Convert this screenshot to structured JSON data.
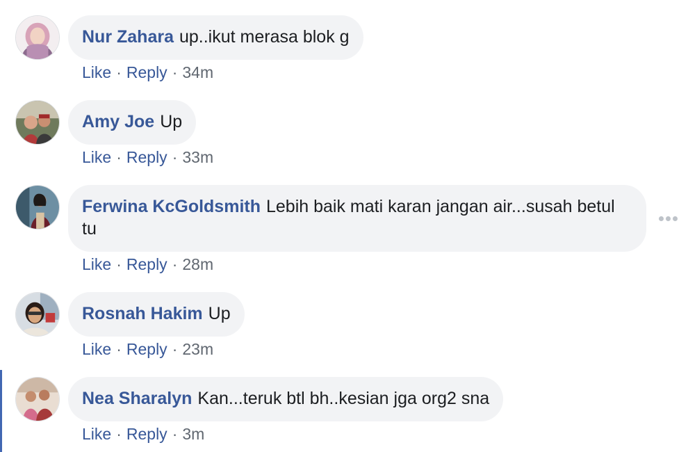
{
  "comments": [
    {
      "author": "Nur Zahara",
      "text": "up..ikut merasa blok g",
      "like": "Like",
      "reply": "Reply",
      "sep": "·",
      "time": "34m",
      "avatar_icon": "user-photo-icon"
    },
    {
      "author": "Amy Joe",
      "text": "Up",
      "like": "Like",
      "reply": "Reply",
      "sep": "·",
      "time": "33m",
      "avatar_icon": "user-photo-icon"
    },
    {
      "author": "Ferwina KcGoldsmith",
      "text": "Lebih baik mati karan jangan air...susah betul tu",
      "like": "Like",
      "reply": "Reply",
      "sep": "·",
      "time": "28m",
      "avatar_icon": "user-photo-icon"
    },
    {
      "author": "Rosnah Hakim",
      "text": "Up",
      "like": "Like",
      "reply": "Reply",
      "sep": "·",
      "time": "23m",
      "avatar_icon": "user-photo-icon"
    },
    {
      "author": "Nea Sharalyn",
      "text": "Kan...teruk btl bh..kesian jga org2 sna",
      "like": "Like",
      "reply": "Reply",
      "sep": "·",
      "time": "3m",
      "avatar_icon": "user-photo-icon"
    }
  ],
  "colors": {
    "author_link": "#385898",
    "bubble_bg": "#f2f3f5",
    "meta_text": "#606770",
    "highlight_bar": "#4267b2"
  },
  "more_options_icon": "more-horizontal-icon"
}
